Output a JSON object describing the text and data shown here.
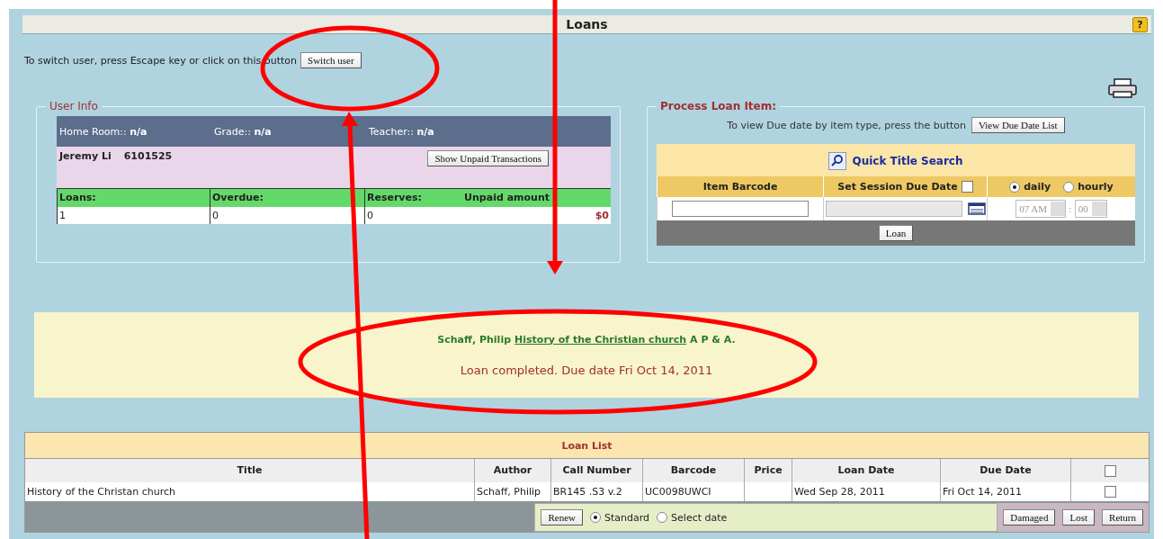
{
  "header": {
    "title": "Loans",
    "help": "?"
  },
  "switch_user": {
    "text": "To switch user, press Escape key or click on this button",
    "button": "Switch user"
  },
  "user_info": {
    "legend": "User Info",
    "fields": [
      {
        "label": "Home Room::",
        "value": "n/a"
      },
      {
        "label": "Grade::",
        "value": "n/a"
      },
      {
        "label": "Teacher::",
        "value": "n/a"
      }
    ],
    "name": "Jeremy Li",
    "id": "6101525",
    "unpaid_button": "Show Unpaid Transactions",
    "stats": [
      {
        "label": "Loans:",
        "value": "1"
      },
      {
        "label": "Overdue:",
        "value": "0"
      },
      {
        "label": "Reserves:",
        "value": "0"
      },
      {
        "label": "Unpaid amount",
        "value": "$0"
      }
    ]
  },
  "process_loan": {
    "legend": "Process Loan Item:",
    "hint": "To view Due date by item type, press the button",
    "due_list_button": "View Due Date List",
    "quick_search": "Quick Title Search",
    "barcode_label": "Item Barcode",
    "session_label": "Set Session Due Date",
    "session_checked": false,
    "modes": [
      {
        "label": "daily",
        "selected": true
      },
      {
        "label": "hourly",
        "selected": false
      }
    ],
    "hour": "07 AM",
    "time_separator": ":",
    "minute": "00",
    "loan_button": "Loan"
  },
  "message": {
    "author": "Schaff, Philip",
    "title_link": "History of the Christian church",
    "suffix": "A P & A.",
    "status": "Loan completed. Due date Fri Oct 14, 2011"
  },
  "loan_list": {
    "title": "Loan List",
    "columns": [
      "Title",
      "Author",
      "Call Number",
      "Barcode",
      "Price",
      "Loan Date",
      "Due Date"
    ],
    "select_all_checked": false,
    "rows": [
      {
        "cells": [
          "History of the Christan church",
          "Schaff, Philip",
          "BR145 .S3 v.2",
          "UC0098UWCI",
          "",
          "Wed Sep 28, 2011",
          "Fri Oct 14, 2011"
        ],
        "checked": false
      }
    ],
    "renew_button": "Renew",
    "renew_modes": [
      {
        "label": "Standard",
        "selected": true
      },
      {
        "label": "Select date",
        "selected": false
      }
    ],
    "actions": [
      "Damaged",
      "Lost",
      "Return"
    ]
  }
}
